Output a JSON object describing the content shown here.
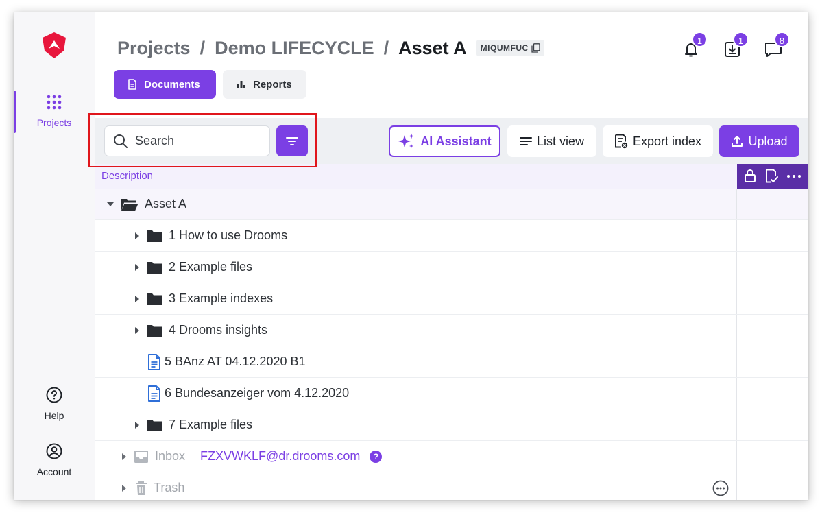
{
  "sidebar": {
    "items": [
      {
        "label": "Projects",
        "icon": "grid-dots-icon",
        "active": true
      },
      {
        "label": "Help",
        "icon": "question-circle-icon"
      },
      {
        "label": "Account",
        "icon": "account-circle-icon"
      }
    ]
  },
  "header": {
    "breadcrumb": [
      "Projects",
      "Demo LIFECYCLE",
      "Asset A"
    ],
    "separator": "/",
    "project_code": "MIQUMFUC",
    "badges": {
      "notifications": "1",
      "downloads": "1",
      "messages": "8"
    }
  },
  "tabs": [
    {
      "label": "Documents",
      "active": true
    },
    {
      "label": "Reports",
      "active": false
    }
  ],
  "toolbar": {
    "search_placeholder": "Search",
    "ai_label": "AI Assistant",
    "list_view_label": "List view",
    "export_label": "Export index",
    "upload_label": "Upload"
  },
  "table": {
    "column_header": "Description",
    "root": "Asset A",
    "rows": [
      {
        "name": "1 How to use Drooms",
        "type": "folder"
      },
      {
        "name": "2 Example files",
        "type": "folder"
      },
      {
        "name": "3 Example indexes",
        "type": "folder"
      },
      {
        "name": "4 Drooms insights",
        "type": "folder"
      },
      {
        "name": "5 BAnz AT 04.12.2020 B1",
        "type": "document"
      },
      {
        "name": "6 Bundesanzeiger vom 4.12.2020",
        "type": "document"
      },
      {
        "name": "7 Example files",
        "type": "folder"
      }
    ],
    "inbox": {
      "label": "Inbox",
      "email": "FZXVWKLF@dr.drooms.com",
      "help": "?"
    },
    "trash": {
      "label": "Trash"
    }
  },
  "colors": {
    "accent": "#7b3fe4",
    "accent_dark": "#5a2ea6",
    "logo": "#e8163c",
    "highlight": "#e0161c"
  }
}
